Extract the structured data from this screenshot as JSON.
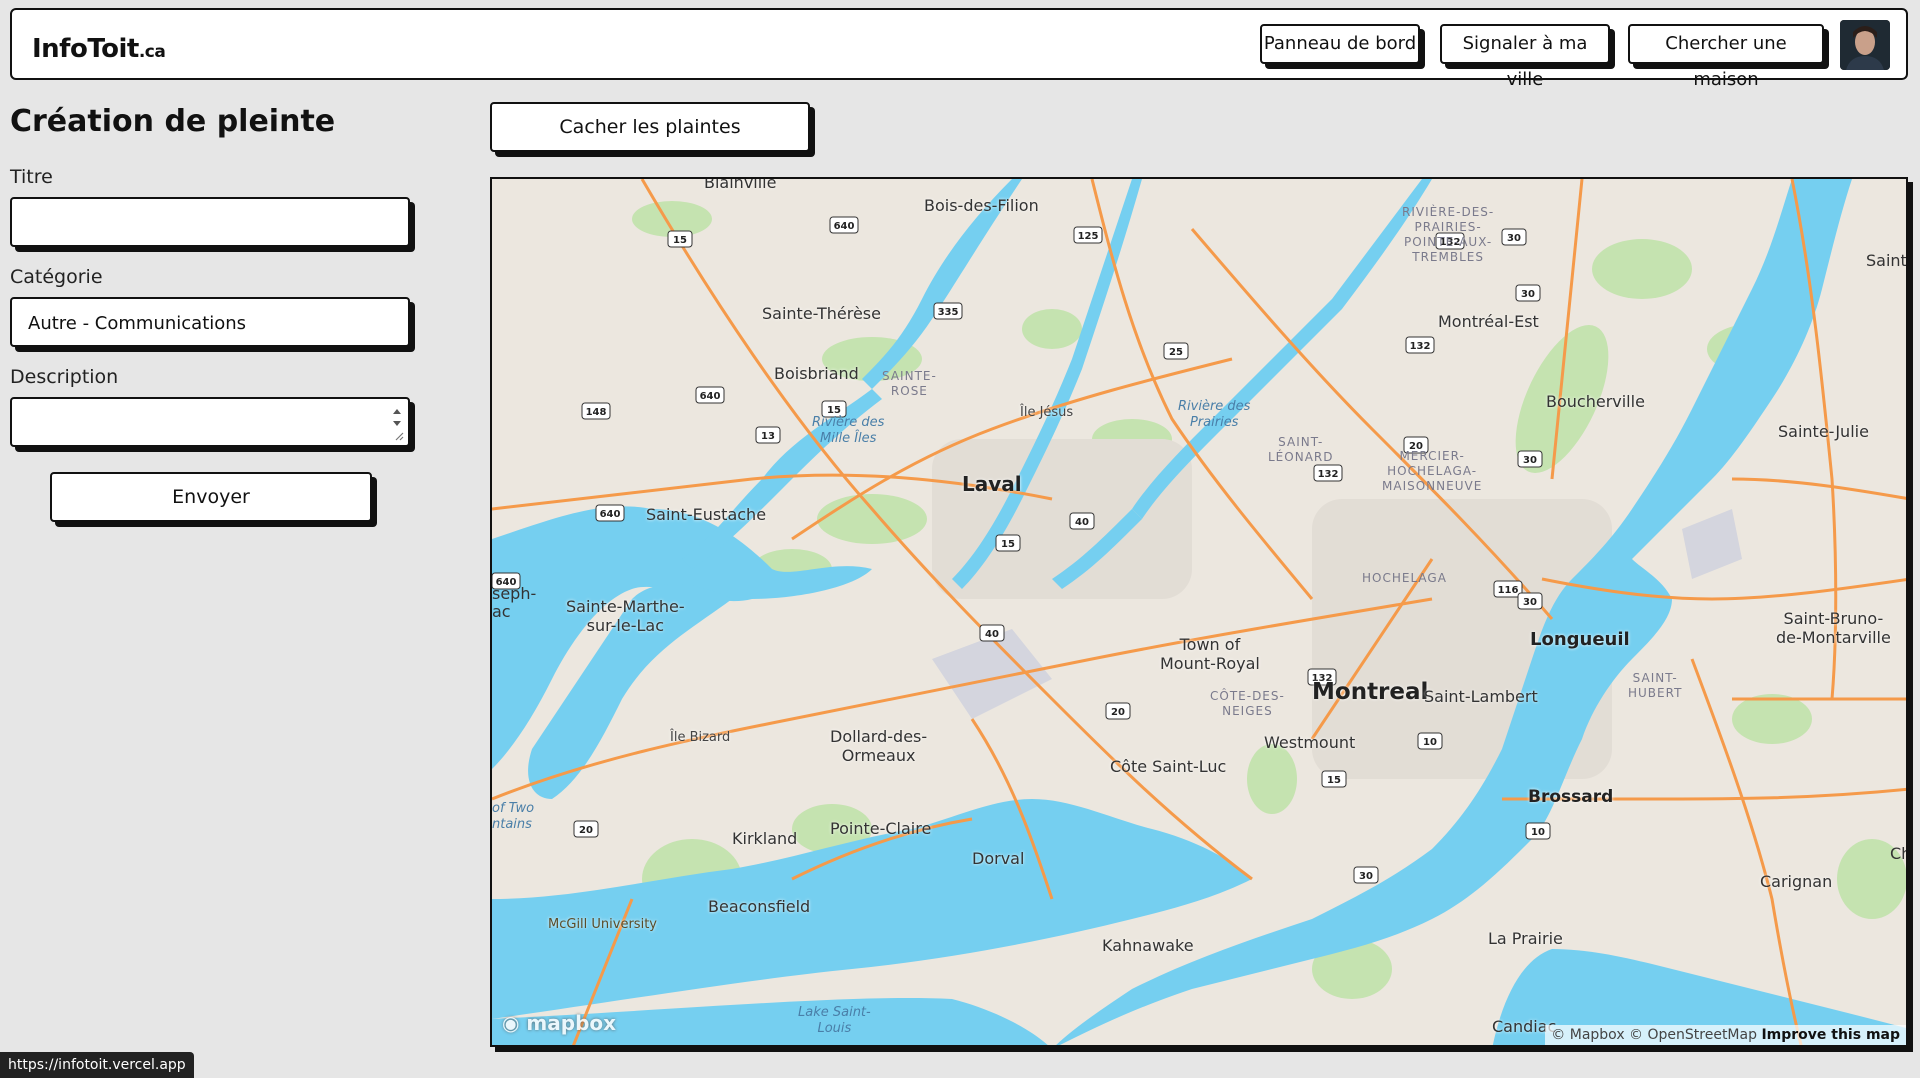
{
  "header": {
    "brand": "InfoToit",
    "brand_tld": ".ca",
    "nav": [
      "Panneau de bord",
      "Signaler à ma ville",
      "Chercher une maison"
    ]
  },
  "form": {
    "title": "Création de pleinte",
    "title_label": "Titre",
    "title_value": "",
    "category_label": "Catégorie",
    "category_value": "Autre - Communications",
    "description_label": "Description",
    "description_value": "",
    "submit_label": "Envoyer"
  },
  "toggle_button": "Cacher les plaintes",
  "map": {
    "labels": {
      "laval": "Laval",
      "montreal": "Montreal",
      "longueuil": "Longueuil",
      "brossard": "Brossard",
      "boucherville": "Boucherville",
      "montreal_est": "Montréal-Est",
      "sainte_julie": "Sainte-Julie",
      "saint_bruno": "Saint-Bruno-",
      "saint_bruno2": "de-Montarville",
      "saint_lambert": "Saint-Lambert",
      "westmount": "Westmount",
      "cote_saint_luc": "Côte Saint-Luc",
      "town_of": "Town of",
      "mount_royal": "Mount-Royal",
      "dorval": "Dorval",
      "pointe_claire": "Pointe-Claire",
      "kirkland": "Kirkland",
      "beaconsfield": "Beaconsfield",
      "dollard": "Dollard-des-",
      "ormeaux": "Ormeaux",
      "kahnawake": "Kahnawake",
      "la_prairie": "La Prairie",
      "candiac": "Candiac",
      "carignan": "Carignan",
      "saint_eustache": "Saint-Eustache",
      "sainte_marthe": "Sainte-Marthe-",
      "sur_le_lac": "sur-le-Lac",
      "boisbriand": "Boisbriand",
      "sainte_therese": "Sainte-Thérèse",
      "bois_des_filion": "Bois-des-Filion",
      "blainville": "Blainville",
      "ile_jesus": "Île Jésus",
      "ile_bizard": "Île Bizard",
      "mcgill": "McGill University",
      "hochelaga": "HOCHELAGA",
      "saint_leonard": "SAINT-\nLÉONARD",
      "cote_des_neiges": "CÔTE-DES-\nNEIGES",
      "saint_hubert": "SAINT-\nHUBERT",
      "sainte_rose": "SAINTE-\nROSE",
      "mercier": "MERCIER-\nHOCHELAGA-\nMAISONNEUVE",
      "riviere_prairies": "RIVIÈRE-DES-\nPRAIRIES-\nPOINTE-AUX-\nTREMBLES",
      "riviere_mille_iles": "Rivière des\nMille Îles",
      "riviere_des_prairies": "Rivière des\nPrairies",
      "lake_saint_louis": "Lake Saint-\nLouis",
      "of_two": "of Two\nntains",
      "seph": "seph-\nac",
      "saint_cut": "Saint-",
      "ch_cut": "Ch"
    },
    "shields": [
      "640",
      "15",
      "125",
      "335",
      "25",
      "148",
      "640",
      "15",
      "13",
      "640",
      "40",
      "15",
      "40",
      "20",
      "132",
      "30",
      "30",
      "132",
      "20",
      "30",
      "132",
      "116",
      "30",
      "132",
      "10",
      "15",
      "10",
      "20",
      "30",
      "640"
    ],
    "logo": "mapbox",
    "attribution": "© Mapbox © OpenStreetMap",
    "improve": "Improve this map"
  },
  "status_url": "https://infotoit.vercel.app",
  "colors": {
    "accent": "#111111",
    "water": "#75cff0",
    "land": "#ece7df",
    "park": "#c5e3b0",
    "highway": "#f59a4a"
  }
}
